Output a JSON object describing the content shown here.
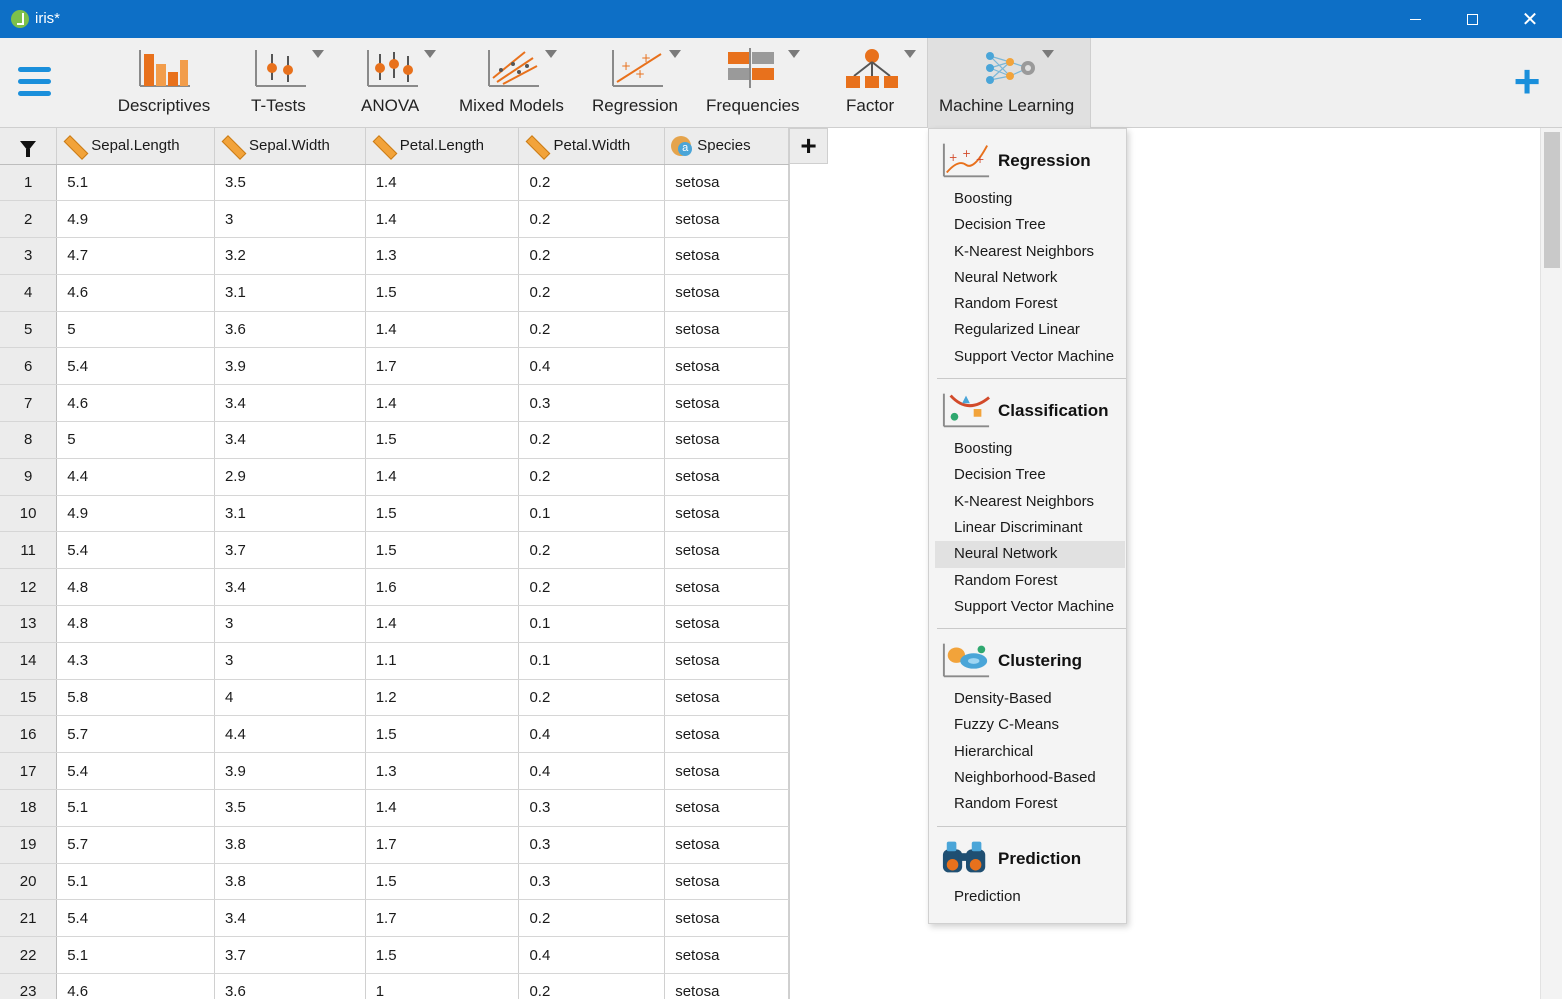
{
  "window": {
    "title": "iris*"
  },
  "ribbon": {
    "items": [
      {
        "label": "Descriptives"
      },
      {
        "label": "T-Tests"
      },
      {
        "label": "ANOVA"
      },
      {
        "label": "Mixed Models"
      },
      {
        "label": "Regression"
      },
      {
        "label": "Frequencies"
      },
      {
        "label": "Factor"
      },
      {
        "label": "Machine Learning"
      }
    ],
    "active": "Machine Learning"
  },
  "grid": {
    "columns": [
      "Sepal.Length",
      "Sepal.Width",
      "Petal.Length",
      "Petal.Width",
      "Species"
    ],
    "column_types": [
      "scale",
      "scale",
      "scale",
      "scale",
      "nominal-text"
    ],
    "rows": [
      [
        "1",
        "5.1",
        "3.5",
        "1.4",
        "0.2",
        "setosa"
      ],
      [
        "2",
        "4.9",
        "3",
        "1.4",
        "0.2",
        "setosa"
      ],
      [
        "3",
        "4.7",
        "3.2",
        "1.3",
        "0.2",
        "setosa"
      ],
      [
        "4",
        "4.6",
        "3.1",
        "1.5",
        "0.2",
        "setosa"
      ],
      [
        "5",
        "5",
        "3.6",
        "1.4",
        "0.2",
        "setosa"
      ],
      [
        "6",
        "5.4",
        "3.9",
        "1.7",
        "0.4",
        "setosa"
      ],
      [
        "7",
        "4.6",
        "3.4",
        "1.4",
        "0.3",
        "setosa"
      ],
      [
        "8",
        "5",
        "3.4",
        "1.5",
        "0.2",
        "setosa"
      ],
      [
        "9",
        "4.4",
        "2.9",
        "1.4",
        "0.2",
        "setosa"
      ],
      [
        "10",
        "4.9",
        "3.1",
        "1.5",
        "0.1",
        "setosa"
      ],
      [
        "11",
        "5.4",
        "3.7",
        "1.5",
        "0.2",
        "setosa"
      ],
      [
        "12",
        "4.8",
        "3.4",
        "1.6",
        "0.2",
        "setosa"
      ],
      [
        "13",
        "4.8",
        "3",
        "1.4",
        "0.1",
        "setosa"
      ],
      [
        "14",
        "4.3",
        "3",
        "1.1",
        "0.1",
        "setosa"
      ],
      [
        "15",
        "5.8",
        "4",
        "1.2",
        "0.2",
        "setosa"
      ],
      [
        "16",
        "5.7",
        "4.4",
        "1.5",
        "0.4",
        "setosa"
      ],
      [
        "17",
        "5.4",
        "3.9",
        "1.3",
        "0.4",
        "setosa"
      ],
      [
        "18",
        "5.1",
        "3.5",
        "1.4",
        "0.3",
        "setosa"
      ],
      [
        "19",
        "5.7",
        "3.8",
        "1.7",
        "0.3",
        "setosa"
      ],
      [
        "20",
        "5.1",
        "3.8",
        "1.5",
        "0.3",
        "setosa"
      ],
      [
        "21",
        "5.4",
        "3.4",
        "1.7",
        "0.2",
        "setosa"
      ],
      [
        "22",
        "5.1",
        "3.7",
        "1.5",
        "0.4",
        "setosa"
      ],
      [
        "23",
        "4.6",
        "3.6",
        "1",
        "0.2",
        "setosa"
      ]
    ]
  },
  "ml_menu": {
    "sections": [
      {
        "title": "Regression",
        "icon": "regression-icon",
        "items": [
          "Boosting",
          "Decision Tree",
          "K-Nearest Neighbors",
          "Neural Network",
          "Random Forest",
          "Regularized Linear",
          "Support Vector Machine"
        ]
      },
      {
        "title": "Classification",
        "icon": "classification-icon",
        "items": [
          "Boosting",
          "Decision Tree",
          "K-Nearest Neighbors",
          "Linear Discriminant",
          "Neural Network",
          "Random Forest",
          "Support Vector Machine"
        ]
      },
      {
        "title": "Clustering",
        "icon": "clustering-icon",
        "items": [
          "Density-Based",
          "Fuzzy C-Means",
          "Hierarchical",
          "Neighborhood-Based",
          "Random Forest"
        ]
      },
      {
        "title": "Prediction",
        "icon": "binoculars-icon",
        "items": [
          "Prediction"
        ]
      }
    ],
    "hovered": "Classification / Neural Network"
  },
  "colors": {
    "titlebar": "#0d6fc6",
    "accent": "#1a8fdb",
    "icon_orange": "#e8711c"
  }
}
